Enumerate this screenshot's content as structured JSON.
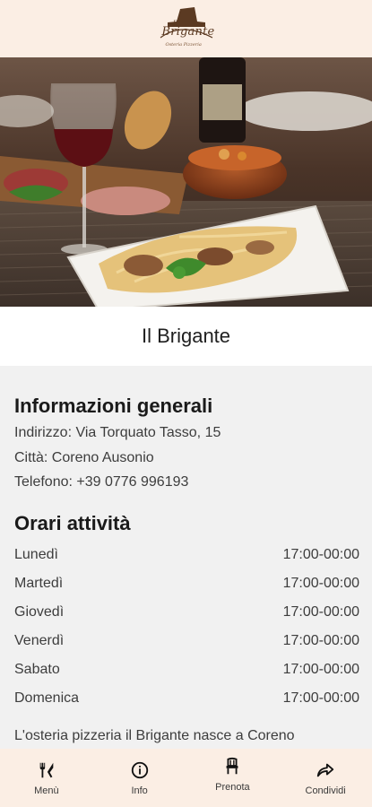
{
  "header": {
    "logo_title": "Brigante",
    "logo_subtitle": "Osteria Pizzeria",
    "logo_icon": "hat-icon"
  },
  "restaurant": {
    "name": "Il Brigante"
  },
  "info": {
    "title": "Informazioni generali",
    "address": "Indirizzo: Via Torquato Tasso, 15",
    "city": "Città: Coreno Ausonio",
    "phone": "Telefono: +39 0776 996193"
  },
  "hours": {
    "title": "Orari attività",
    "rows": [
      {
        "day": "Lunedì",
        "time": "17:00-00:00"
      },
      {
        "day": "Martedì",
        "time": "17:00-00:00"
      },
      {
        "day": "Giovedì",
        "time": "17:00-00:00"
      },
      {
        "day": "Venerdì",
        "time": "17:00-00:00"
      },
      {
        "day": "Sabato",
        "time": "17:00-00:00"
      },
      {
        "day": "Domenica",
        "time": "17:00-00:00"
      }
    ]
  },
  "description": "L'osteria pizzeria il Brigante nasce a Coreno",
  "nav": {
    "items": [
      {
        "label": "Menù",
        "icon": "cutlery-icon"
      },
      {
        "label": "Info",
        "icon": "info-icon"
      },
      {
        "label": "Prenota",
        "icon": "chair-icon"
      },
      {
        "label": "Condividi",
        "icon": "share-icon"
      }
    ]
  },
  "colors": {
    "bar_bg": "#fbeee4",
    "page_bg": "#f1f1f1",
    "logo_brown": "#5b3a22"
  }
}
